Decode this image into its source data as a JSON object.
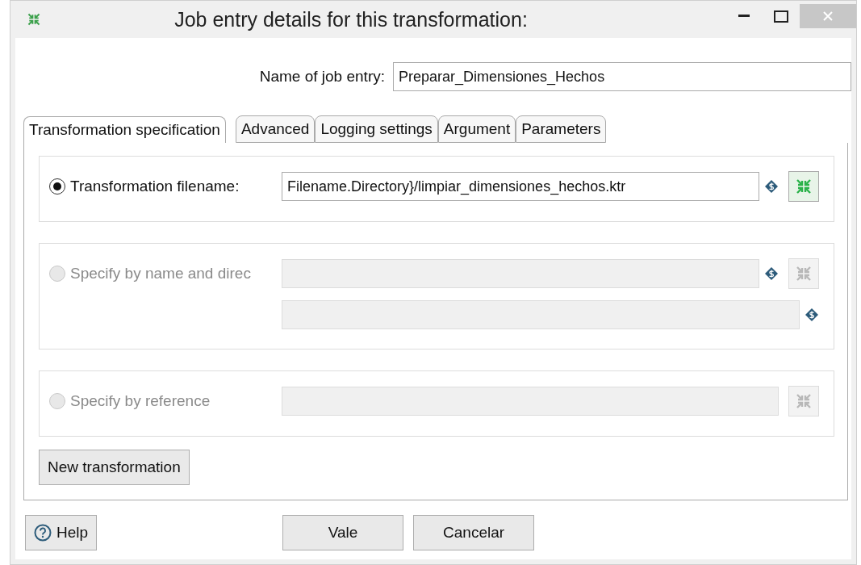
{
  "window": {
    "title": "Job entry details for this transformation:"
  },
  "name_field": {
    "label": "Name of job entry:",
    "value": "Preparar_Dimensiones_Hechos"
  },
  "tabs": [
    {
      "label": "Transformation specification",
      "selected": true
    },
    {
      "label": "Advanced",
      "selected": false
    },
    {
      "label": "Logging settings",
      "selected": false
    },
    {
      "label": "Argument",
      "selected": false
    },
    {
      "label": "Parameters",
      "selected": false
    }
  ],
  "sections": [
    {
      "kind": "filename",
      "label": "Transformation filename:",
      "selected": true,
      "disabled": false,
      "value": "Filename.Directory}/limpiar_dimensiones_hechos.ktr"
    },
    {
      "kind": "name_dir",
      "label": "Specify by name and direc",
      "selected": false,
      "disabled": true
    },
    {
      "kind": "reference",
      "label": "Specify by reference",
      "selected": false,
      "disabled": true
    }
  ],
  "new_button": "New transformation",
  "help_button": "Help",
  "buttons": [
    "Vale",
    "Cancelar"
  ]
}
